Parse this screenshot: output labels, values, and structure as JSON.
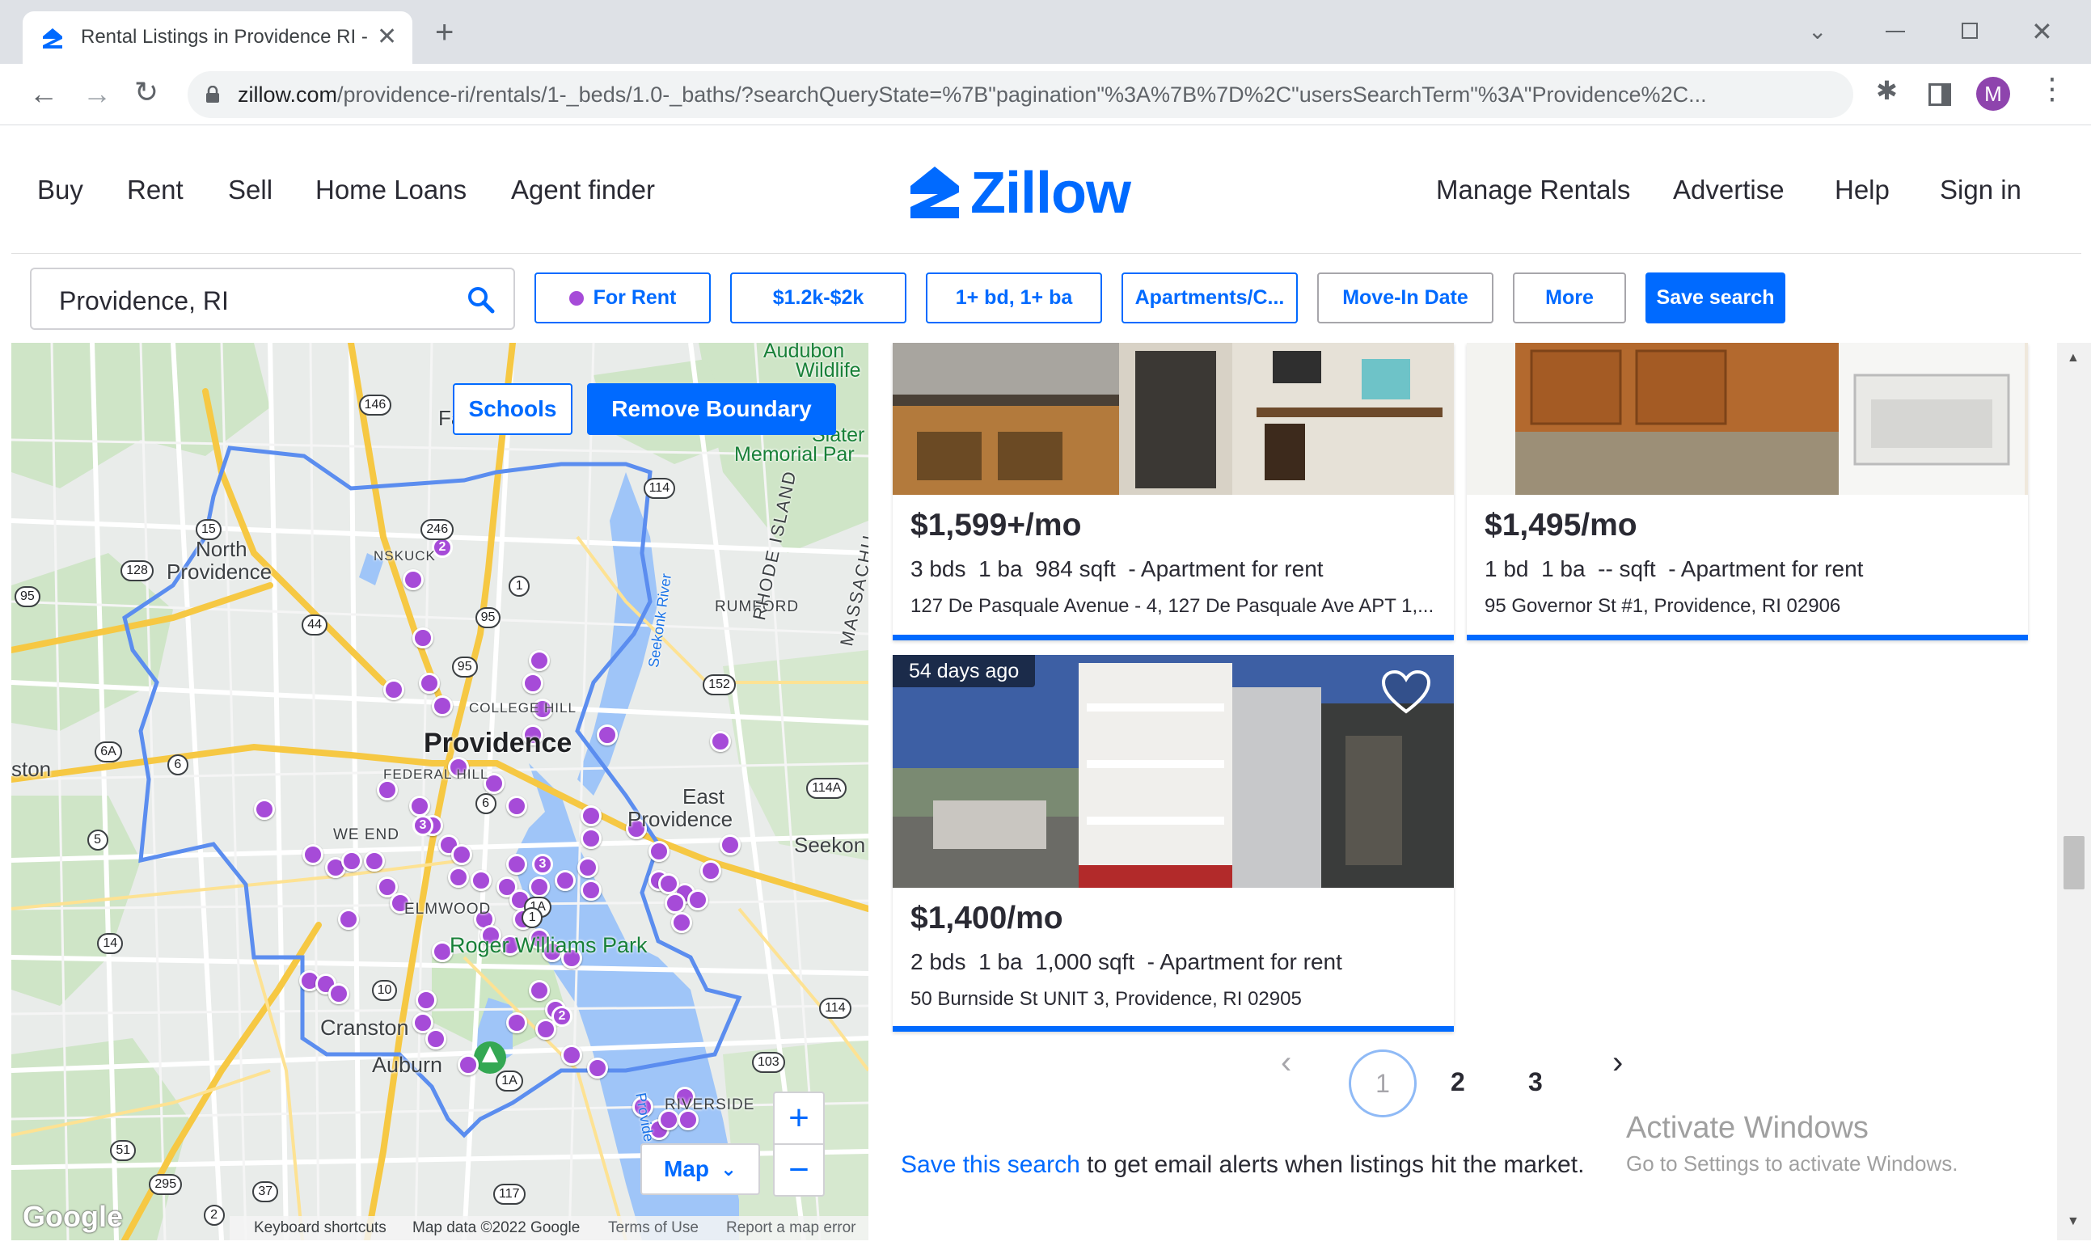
{
  "browser": {
    "tab_title": "Rental Listings in Providence RI - ",
    "url_host": "zillow.com",
    "url_path": "/providence-ri/rentals/1-_beds/1.0-_baths/?searchQueryState=%7B\"pagination\"%3A%7B%7D%2C\"usersSearchTerm\"%3A\"Providence%2C...",
    "profile_initial": "M"
  },
  "header": {
    "nav_left": [
      "Buy",
      "Rent",
      "Sell",
      "Home Loans",
      "Agent finder"
    ],
    "logo_text": "Zillow",
    "nav_right": [
      "Manage Rentals",
      "Advertise",
      "Help",
      "Sign in"
    ]
  },
  "search": {
    "value": "Providence, RI"
  },
  "filters": {
    "for_rent": "For Rent",
    "price": "$1.2k-$2k",
    "beds_baths": "1+ bd, 1+ ba",
    "home_type": "Apartments/C...",
    "move_in": "Move-In Date",
    "more": "More",
    "save_search": "Save search"
  },
  "map": {
    "schools_button": "Schools",
    "remove_boundary_button": "Remove Boundary",
    "map_type_button": "Map",
    "zoom_in": "+",
    "zoom_out": "−",
    "google_logo": "Google",
    "footer": {
      "shortcuts": "Keyboard shortcuts",
      "data": "Map data ©2022 Google",
      "terms": "Terms of Use",
      "report": "Report a map error"
    },
    "labels": {
      "north_providence_1": "North",
      "north_providence_2": "Providence",
      "east_providence_1": "East",
      "east_providence_2": "Providence",
      "cranston": "Cranston",
      "auburn": "Auburn",
      "rumford": "RUMFORD",
      "riverside": "RIVERSIDE",
      "seekonk": "Seekon",
      "johnston": "ston",
      "elmwood": "ELMWOOD",
      "west_end": "WE  END",
      "roger_williams": "Roger Williams Park",
      "audubon_1": "Audubon",
      "audubon_2": "Wildlife",
      "slater_1": "Slater",
      "slater_2": "Memorial Par",
      "providence_city": "Providence",
      "rhode_island": "RHODE ISLAND",
      "massachusetts": "MASSACHU",
      "seekonk_river": "Seekonk River",
      "providence_river": "Provide",
      "fa": "Fa",
      "college_hill": "COLLEGE HILL",
      "federal_hill": "FEDERAL HILL",
      "fruit_hill": "NSKUCK"
    },
    "route_shields": [
      "146",
      "246",
      "114",
      "15",
      "128",
      "95",
      "1",
      "44",
      "95",
      "152",
      "6A",
      "6",
      "5",
      "6",
      "114A",
      "1A",
      "14",
      "10",
      "114",
      "103",
      "1A",
      "51",
      "295",
      "37",
      "117",
      "2",
      "95",
      "1"
    ],
    "cluster_counts": [
      "2",
      "3",
      "3",
      "2"
    ]
  },
  "listings": [
    {
      "price": "$1,599+/mo",
      "beds": "3 bds",
      "baths": "1 ba",
      "sqft": "984 sqft",
      "type": "- Apartment for rent",
      "address": "127 De Pasquale Avenue - 4, 127 De Pasquale Ave APT 1,..."
    },
    {
      "price": "$1,495/mo",
      "beds": "1 bd",
      "baths": "1 ba",
      "sqft": "-- sqft",
      "type": "- Apartment for rent",
      "address": "95 Governor St #1, Providence, RI 02906"
    },
    {
      "badge": "54 days ago",
      "price": "$1,400/mo",
      "beds": "2 bds",
      "baths": "1 ba",
      "sqft": "1,000 sqft",
      "type": "- Apartment for rent",
      "address": "50 Burnside St UNIT 3, Providence, RI 02905"
    }
  ],
  "pagination": {
    "pages": [
      "1",
      "2",
      "3"
    ],
    "current": "1"
  },
  "save_prompt": {
    "link": "Save this search",
    "rest": "to get email alerts when listings hit the market."
  },
  "watermark": {
    "line1": "Activate Windows",
    "line2": "Go to Settings to activate Windows."
  },
  "colors": {
    "brand_blue": "#006aff",
    "marker_purple": "#a64bd8",
    "boundary": "#5b8def",
    "text": "#2a2a33"
  }
}
